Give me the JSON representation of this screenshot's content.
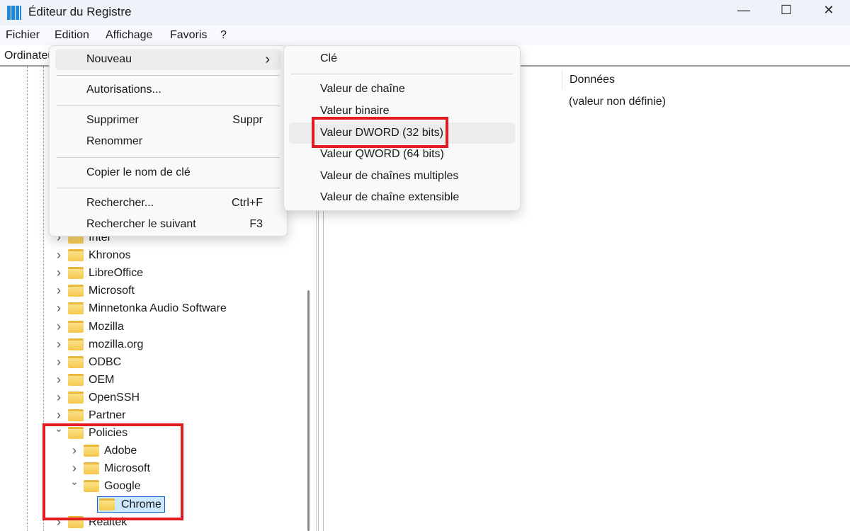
{
  "window": {
    "title": "Éditeur du Registre",
    "controls": [
      "—",
      "☐",
      "✕"
    ]
  },
  "menubar": [
    "Fichier",
    "Edition",
    "Affichage",
    "Favoris",
    "?"
  ],
  "address": {
    "label": "Ordinateur"
  },
  "list": {
    "column_data": "Données",
    "row_data": "(valeur non définie)"
  },
  "tree": {
    "items": [
      "Intel",
      "Khronos",
      "LibreOffice",
      "Microsoft",
      "Minnetonka Audio Software",
      "Mozilla",
      "mozilla.org",
      "ODBC",
      "OEM",
      "OpenSSH",
      "Partner",
      "Policies",
      "Realtek"
    ],
    "policies_children": [
      "Adobe",
      "Microsoft",
      "Google"
    ],
    "google_children": [
      "Chrome"
    ],
    "selected": "Chrome"
  },
  "edit_menu": {
    "items": [
      {
        "label": "Nouveau",
        "shortcut": "›"
      },
      {
        "label": "Autorisations...",
        "shortcut": ""
      },
      {
        "label": "Supprimer",
        "shortcut": "Suppr"
      },
      {
        "label": "Renommer",
        "shortcut": ""
      },
      {
        "label": "Copier le nom de clé",
        "shortcut": ""
      },
      {
        "label": "Rechercher...",
        "shortcut": "Ctrl+F"
      },
      {
        "label": "Rechercher le suivant",
        "shortcut": "F3"
      }
    ]
  },
  "new_submenu": {
    "items": [
      "Clé",
      "Valeur de chaîne",
      "Valeur binaire",
      "Valeur DWORD (32 bits)",
      "Valeur QWORD (64 bits)",
      "Valeur de chaînes multiples",
      "Valeur de chaîne extensible"
    ],
    "highlighted": "Valeur DWORD (32 bits)"
  },
  "colors": {
    "highlight_box": "#e31b23",
    "selection": "#cce8ff"
  }
}
